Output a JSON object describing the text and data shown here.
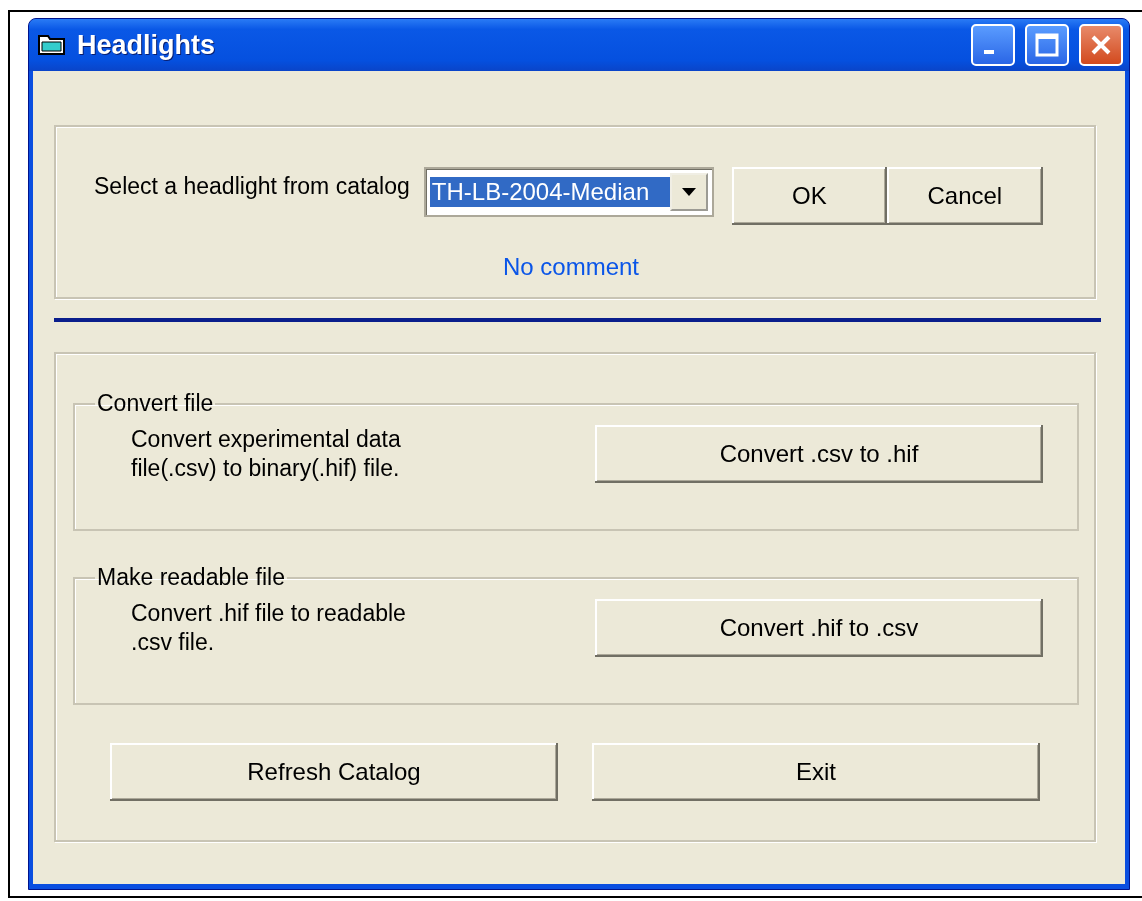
{
  "window": {
    "title": "Headlights"
  },
  "catalog": {
    "label": "Select a headlight from catalog",
    "value": "TH-LB-2004-Median",
    "highlighted": true,
    "comment": "No comment"
  },
  "dialog_buttons": [
    "OK",
    "Cancel"
  ],
  "sections": [
    {
      "title": "Convert file",
      "description": "Convert experimental data file(.csv) to binary(.hif) file.",
      "button": "Convert .csv to .hif"
    },
    {
      "title": "Make readable file",
      "description": "Convert .hif file to readable .csv file.",
      "button": "Convert .hif to .csv"
    }
  ],
  "footer_buttons": [
    "Refresh Catalog",
    "Exit"
  ]
}
